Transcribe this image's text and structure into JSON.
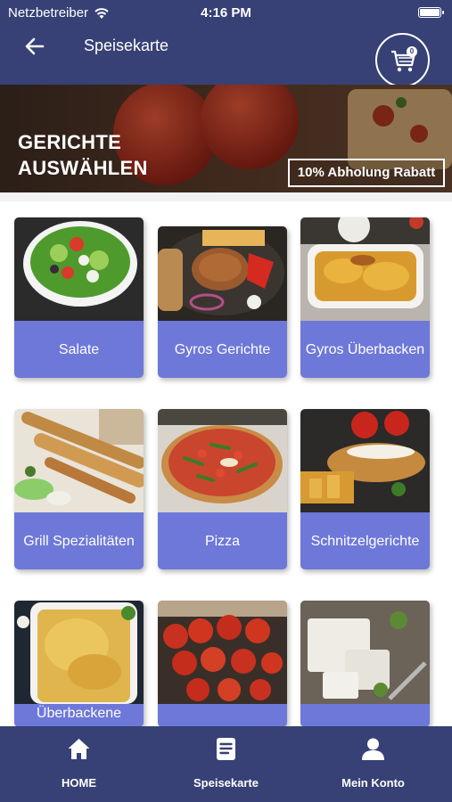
{
  "status_bar": {
    "carrier": "Netzbetreiber",
    "time": "4:16 PM"
  },
  "header": {
    "title": "Speisekarte",
    "cart_count": "0"
  },
  "banner": {
    "title": "GERICHTE\nAUSWÄHLEN",
    "badge": "10% Abholung Rabatt"
  },
  "categories": [
    {
      "label": "Salate",
      "image": "salad-bowl"
    },
    {
      "label": "Gyros Gerichte",
      "image": "gyros-plate"
    },
    {
      "label": "Gyros Überbacken",
      "image": "baked-gyros-dish"
    },
    {
      "label": "Grill Spezialitäten",
      "image": "grill-skewers"
    },
    {
      "label": "Pizza",
      "image": "pizza"
    },
    {
      "label": "Schnitzelgerichte",
      "image": "schnitzel-plate"
    },
    {
      "label": "Überbackene",
      "image": "baked-casserole"
    },
    {
      "label": "",
      "image": "grilled-tomatoes"
    },
    {
      "label": "",
      "image": "feta-cheese"
    }
  ],
  "tabbar": {
    "items": [
      {
        "label": "HOME",
        "icon": "home-icon"
      },
      {
        "label": "Speisekarte",
        "icon": "menu-document-icon"
      },
      {
        "label": "Mein Konto",
        "icon": "account-icon"
      }
    ]
  },
  "colors": {
    "primary": "#374175",
    "tile_label": "#6e78d8"
  }
}
